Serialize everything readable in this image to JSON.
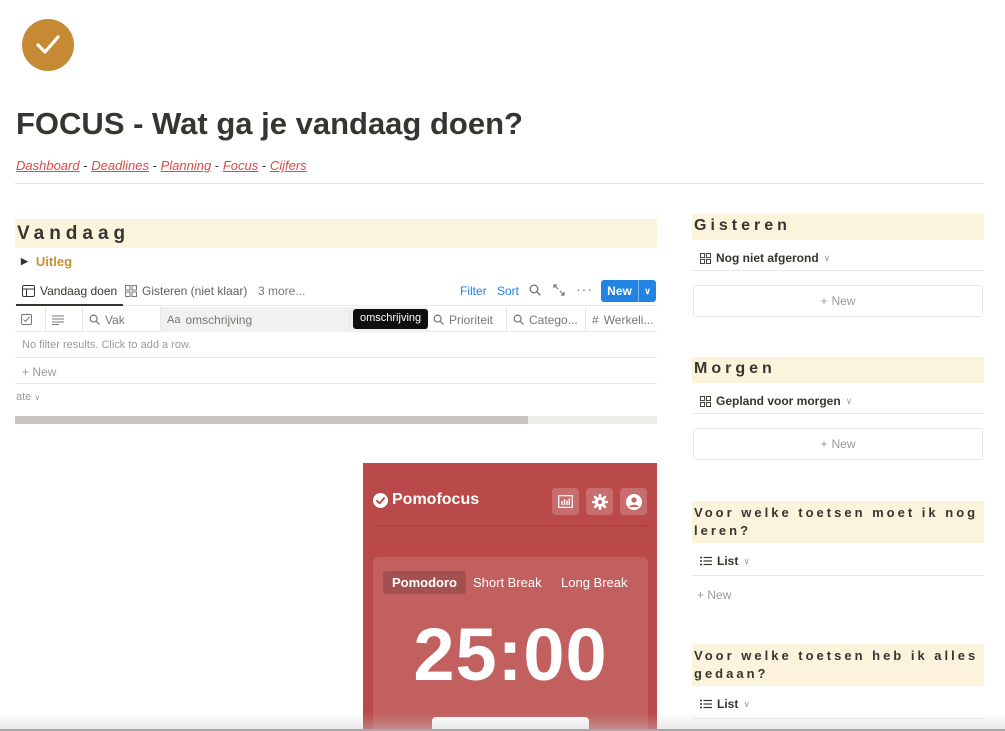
{
  "page": {
    "icon": "checkmark-circle-icon",
    "title": "FOCUS - Wat ga je vandaag doen?",
    "breadcrumb": [
      {
        "label": "Dashboard"
      },
      {
        "label": "Deadlines"
      },
      {
        "label": "Planning"
      },
      {
        "label": "Focus"
      },
      {
        "label": "Cijfers"
      }
    ],
    "separator": "-"
  },
  "vandaag": {
    "heading": "Vandaag",
    "toggle_label": "Uitleg",
    "tabs": [
      {
        "label": "Vandaag doen",
        "icon": "table-icon"
      },
      {
        "label": "Gisteren (niet klaar)",
        "icon": "gallery-icon"
      },
      {
        "label": "3 more..."
      }
    ],
    "toolbar": {
      "filter": "Filter",
      "sort": "Sort",
      "new": "New"
    },
    "columns": [
      {
        "label": "",
        "icon": "checkbox-icon"
      },
      {
        "label": "",
        "icon": "text-icon"
      },
      {
        "label": "Vak",
        "icon": "search-icon"
      },
      {
        "label": "omschrijving",
        "icon": "title-icon",
        "prefix": "Aa"
      },
      {
        "label": "omschrijving",
        "icon": "title-icon"
      },
      {
        "label": "Prioriteit",
        "icon": "search-icon"
      },
      {
        "label": "Catego...",
        "icon": "search-icon"
      },
      {
        "label": "Werkeli...",
        "icon": "number-icon",
        "prefix": "#"
      }
    ],
    "tooltip": "omschrijving",
    "empty_message": "No filter results. Click to add a row.",
    "new_row": "New",
    "calc": "ate"
  },
  "pomofocus": {
    "logo": "Pomofocus",
    "modes": [
      "Pomodoro",
      "Short Break",
      "Long Break"
    ],
    "active_mode": "Pomodoro",
    "timer": "25:00"
  },
  "right": {
    "gisteren": {
      "heading": "Gisteren",
      "view": "Nog niet afgerond",
      "new": "New"
    },
    "morgen": {
      "heading": "Morgen",
      "view": "Gepland voor morgen",
      "new": "New"
    },
    "toetsen_leren": {
      "heading": "Voor welke toetsen moet ik nog leren?",
      "view": "List",
      "new": "New"
    },
    "toetsen_gedaan": {
      "heading": "Voor welke toetsen heb ik alles gedaan?",
      "view": "List"
    }
  },
  "colors": {
    "accent": "#2383e2",
    "highlight": "#fbf3db",
    "link": "#d44c47",
    "toggle": "#cb912f",
    "pomodoro": "#ba4949",
    "icon_bg": "#c68a34"
  }
}
